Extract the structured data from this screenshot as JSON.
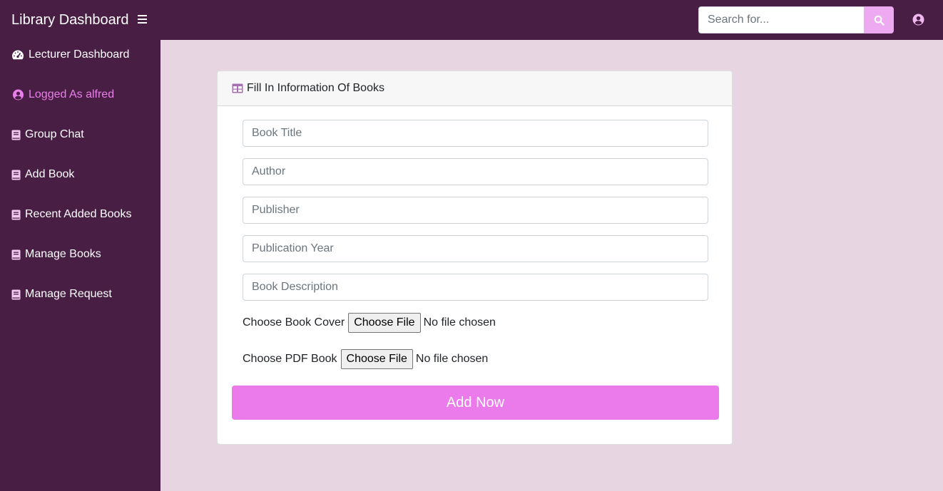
{
  "app": {
    "title": "Library Dashboard"
  },
  "search": {
    "placeholder": "Search for...",
    "value": ""
  },
  "sidebar": {
    "items": [
      {
        "label": "Lecturer Dashboard",
        "icon": "tachometer-icon"
      },
      {
        "label": "Logged As alfred",
        "icon": "user-circle-icon"
      },
      {
        "label": "Group Chat",
        "icon": "book-icon"
      },
      {
        "label": "Add Book",
        "icon": "book-icon"
      },
      {
        "label": "Recent Added Books",
        "icon": "book-icon"
      },
      {
        "label": "Manage Books",
        "icon": "book-icon"
      },
      {
        "label": "Manage Request",
        "icon": "book-icon"
      }
    ]
  },
  "form": {
    "header": "Fill In Information Of Books",
    "fields": [
      {
        "placeholder": "Book Title",
        "value": ""
      },
      {
        "placeholder": "Author",
        "value": ""
      },
      {
        "placeholder": "Publisher",
        "value": ""
      },
      {
        "placeholder": "Publication Year",
        "value": ""
      },
      {
        "placeholder": "Book Description",
        "value": ""
      }
    ],
    "cover": {
      "label": "Choose Book Cover",
      "button": "Choose File",
      "status": "No file chosen"
    },
    "pdf": {
      "label": "Choose PDF Book",
      "button": "Choose File",
      "status": "No file chosen"
    },
    "submit_label": "Add Now"
  },
  "colors": {
    "topbar": "#481e45",
    "sidebar": "#481e45",
    "page_background": "#e8d5e2",
    "accent": "#eb7aeb",
    "active_nav": "#e97fe9",
    "search_button": "#eeaaf0"
  }
}
